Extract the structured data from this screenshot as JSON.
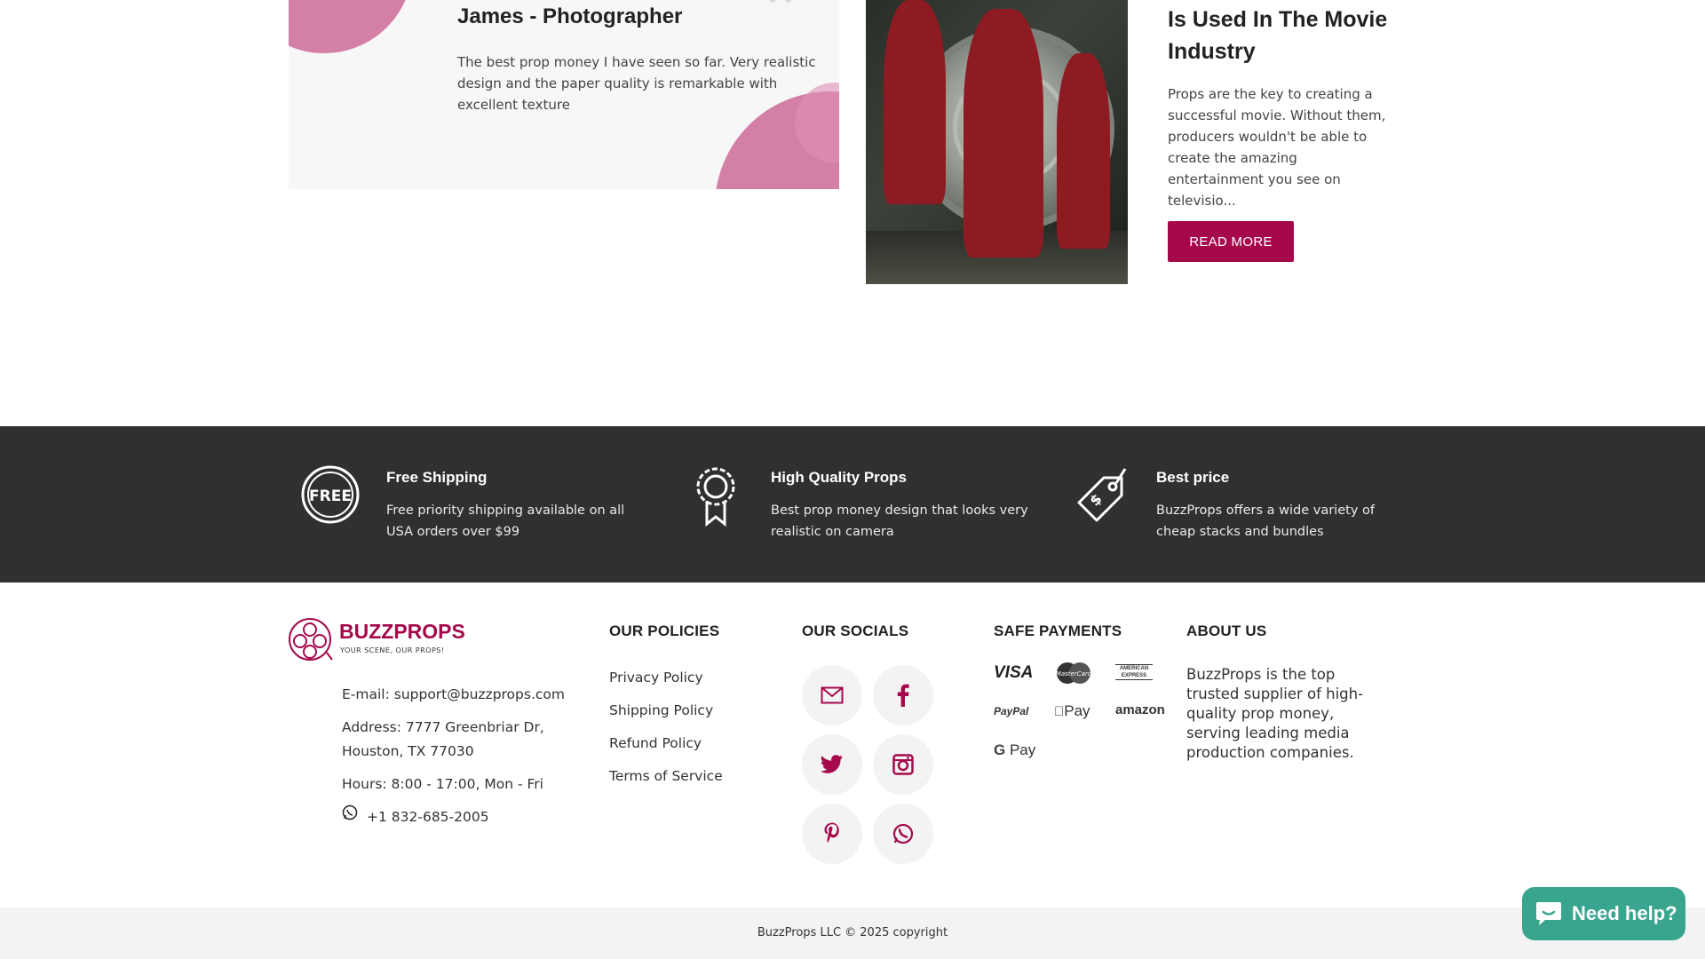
{
  "testimonial": {
    "name": "James - Photographer",
    "quote_mark": "”",
    "text": "The best prop money I have seen so far. Very realistic design and the paper quality is remarkable with excellent texture"
  },
  "blog": {
    "title": "Is Used In The Movie Industry",
    "text": "Props are the key to creating a successful movie. Without them, producers wouldn't be able to create the amazing entertainment you see on televisio...",
    "button": "READ MORE"
  },
  "features": [
    {
      "icon": "free-badge-icon",
      "icon_text": "FREE",
      "title": "Free Shipping",
      "text": "Free priority shipping available on all USA orders over $99"
    },
    {
      "icon": "award-ribbon-icon",
      "title": "High Quality Props",
      "text": "Best prop money design that looks very realistic on camera"
    },
    {
      "icon": "price-tag-icon",
      "title": "Best price",
      "text": "BuzzProps offers a wide variety of cheap stacks and bundles"
    }
  ],
  "footer": {
    "brand": {
      "name": "BUZZPROPS",
      "tagline": "YOUR SCENE, OUR PROPS!"
    },
    "contact": {
      "email": "E-mail: support@buzzprops.com",
      "address_line1": "Address: 7777 Greenbriar Dr,",
      "address_line2": "Houston, TX 77030",
      "hours": "Hours: 8:00 - 17:00, Mon - Fri",
      "phone": "+1 832-685-2005"
    },
    "policies": {
      "heading": "OUR POLICIES",
      "links": [
        "Privacy Policy",
        "Shipping Policy",
        "Refund Policy",
        "Terms of Service"
      ]
    },
    "socials": {
      "heading": "OUR SOCIALS",
      "items": [
        "email-icon",
        "facebook-icon",
        "twitter-icon",
        "instagram-icon",
        "pinterest-icon",
        "whatsapp-icon"
      ]
    },
    "payments": {
      "heading": "SAFE PAYMENTS",
      "items": [
        "VISA",
        "MasterCard",
        "AMERICAN EXPRESS",
        "PayPal",
        "Pay",
        "amazon",
        "Pay"
      ]
    },
    "about": {
      "heading": "ABOUT US",
      "text": "BuzzProps is the top trusted supplier of high-quality prop money, serving leading media production companies."
    },
    "copyright": "BuzzProps LLC © 2025 copyright"
  },
  "chat": {
    "label": "Need help?"
  },
  "colors": {
    "brand": "#a5094c",
    "accent_pink": "#d47fa6",
    "dark_band": "#303030",
    "chat_green": "#3aa58f"
  }
}
